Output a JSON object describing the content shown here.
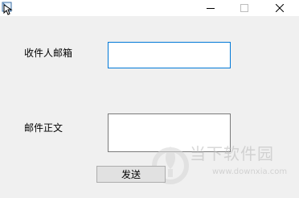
{
  "window": {
    "icon": "app-icon",
    "controls": {
      "minimize": "minimize-icon",
      "maximize": "maximize-icon",
      "close": "close-icon"
    }
  },
  "form": {
    "recipient_label": "收件人邮箱",
    "recipient_value": "",
    "body_label": "邮件正文",
    "body_value": "",
    "send_label": "发送"
  },
  "watermark": {
    "logo": "downxia-logo",
    "text": "当下软件园",
    "url": "www.downxia.com"
  }
}
